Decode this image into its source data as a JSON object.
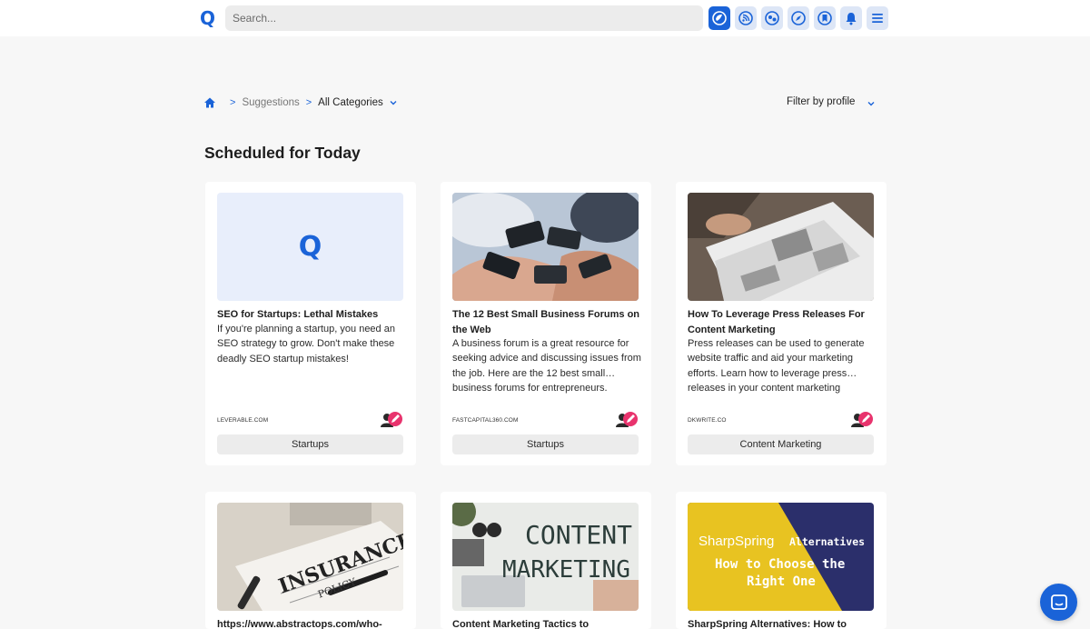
{
  "app": {
    "logo_letter": "Q",
    "brand_color": "#1a63d8"
  },
  "search": {
    "placeholder": "Search..."
  },
  "nav_icons": [
    {
      "name": "suggestions-icon",
      "active": true
    },
    {
      "name": "feeds-icon",
      "active": false
    },
    {
      "name": "accounts-icon",
      "active": false
    },
    {
      "name": "explore-icon",
      "active": false
    },
    {
      "name": "bookmarks-icon",
      "active": false
    },
    {
      "name": "notifications-icon",
      "active": false
    },
    {
      "name": "menu-icon",
      "active": false
    }
  ],
  "breadcrumb": {
    "items": [
      "Suggestions",
      "All Categories"
    ]
  },
  "filter": {
    "label": "Filter by profile"
  },
  "section": {
    "title": "Scheduled for Today"
  },
  "cards": [
    {
      "title": "SEO for Startups: Lethal Mistakes",
      "description": "If you're planning a startup, you need an SEO strategy to grow. Don't make these deadly SEO startup mistakes!",
      "source": "LEVERABLE.COM",
      "tag": "Startups",
      "thumb": "placeholder-logo",
      "thumb_letter": "Q"
    },
    {
      "title": "The 12 Best Small Business Forums on the Web",
      "description": "A business forum is a great resource for seeking advice and discussing issues from the job. Here are the 12 best small… business forums for entrepreneurs.",
      "source": "FASTCAPITAL360.COM",
      "tag": "Startups",
      "thumb": "phones-photo"
    },
    {
      "title": "How To Leverage Press Releases For Content Marketing",
      "description": "Press releases can be used to generate website traffic and aid your marketing efforts. Learn how to leverage press… releases in your content marketing",
      "source": "DKWRITE.CO",
      "tag": "Content Marketing",
      "thumb": "newspaper-photo"
    },
    {
      "title": "https://www.abstractops.com/who-",
      "thumb": "insurance-photo",
      "thumb_text": [
        "INSURANCE",
        "POLICY"
      ]
    },
    {
      "title": "Content Marketing Tactics to",
      "thumb": "content-marketing-photo",
      "thumb_text": [
        "CONTENT",
        "MARKETING"
      ]
    },
    {
      "title": "SharpSpring Alternatives: How to",
      "thumb": "sharpspring-graphic",
      "thumb_text": [
        "SharpSpring",
        "Alternatives",
        "How to Choose the",
        "Right One"
      ]
    }
  ],
  "colors": {
    "background": "#f7f7f7",
    "tag_bg": "#ececec",
    "sharpspring_yellow": "#e8c321",
    "sharpspring_navy": "#2b2f6b"
  }
}
